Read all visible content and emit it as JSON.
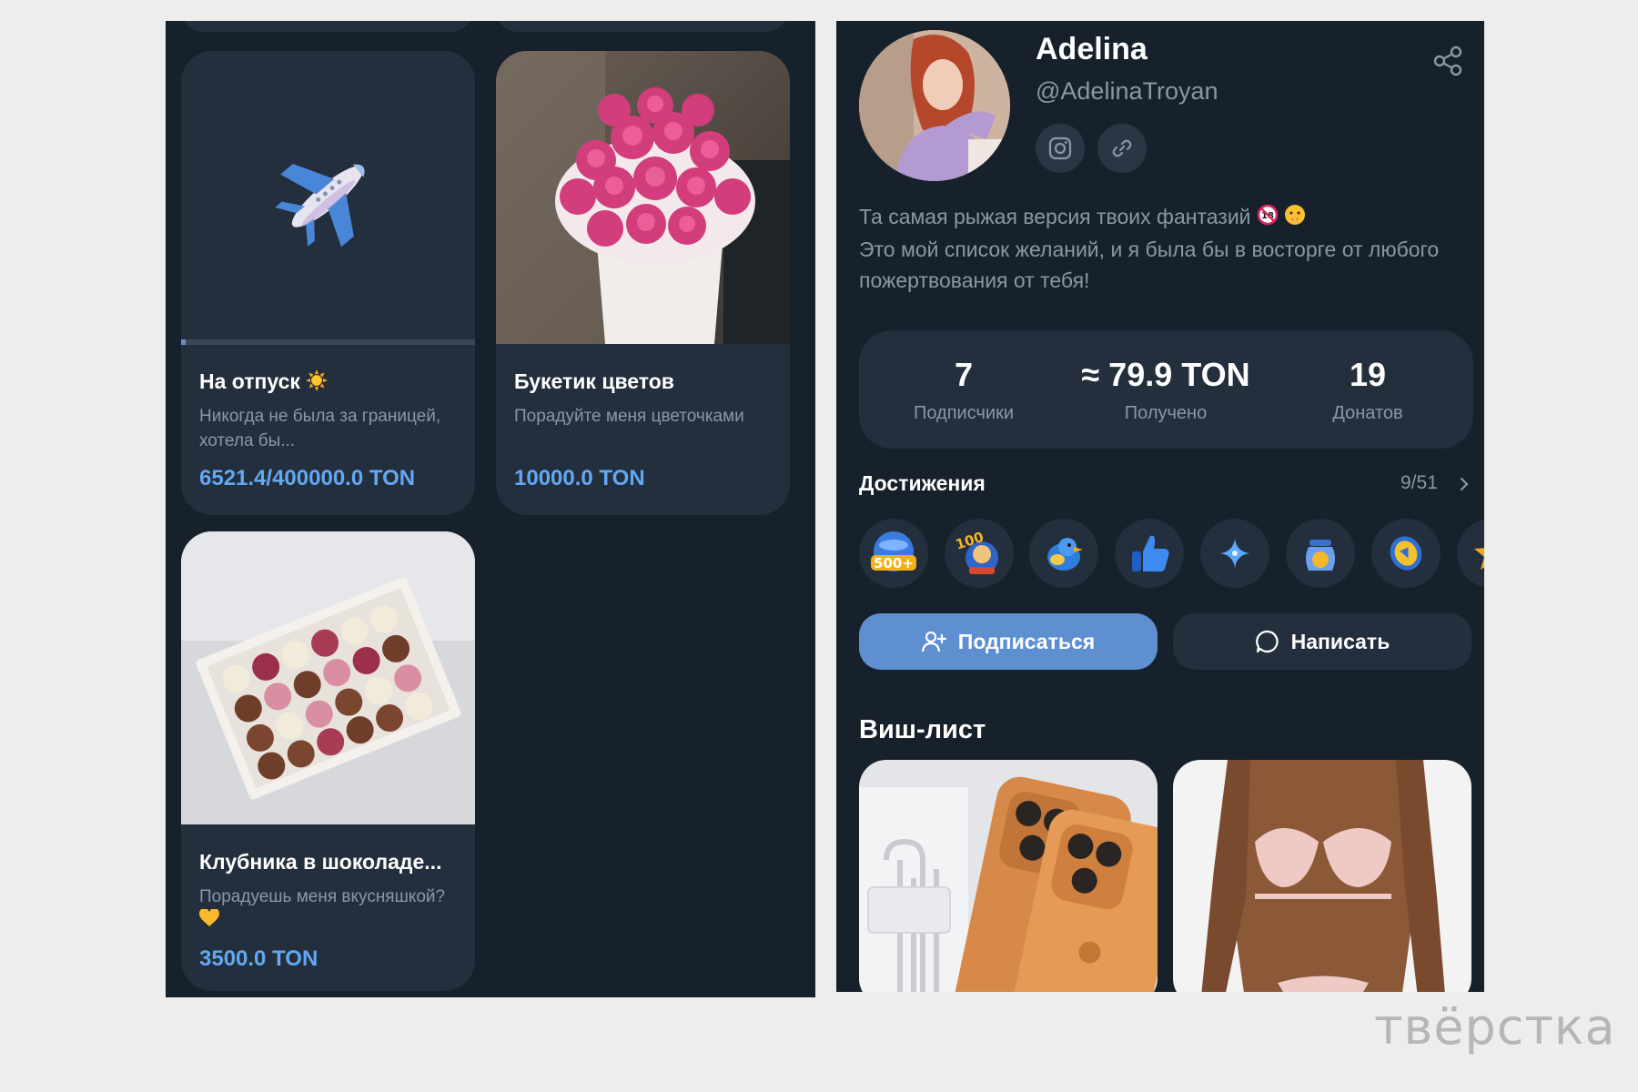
{
  "wishlist_cards": [
    {
      "title": "На отпуск",
      "description": "Никогда не была за границей, хотела бы...",
      "price": "6521.4/400000.0 TON",
      "progress_percent": 1.6,
      "image": "airplane-icon"
    },
    {
      "title": "Букетик цветов",
      "description": "Порадуйте меня цветочками",
      "price": "10000.0 TON",
      "image": "pink-roses-box-photo"
    },
    {
      "title": "Клубника в шоколаде...",
      "description": "Порадуешь меня вкусняшкой?",
      "price": "3500.0 TON",
      "image": "chocolate-strawberries-photo"
    }
  ],
  "profile": {
    "name": "Adelina",
    "handle": "@AdelinaTroyan",
    "bio_line1": "Та самая рыжая версия твоих фантазий",
    "bio_line2": "Это мой список желаний, и я была бы в восторге от любого пожертвования от тебя!"
  },
  "stats": [
    {
      "value": "7",
      "label": "Подписчики"
    },
    {
      "value": "≈ 79.9 TON",
      "label": "Получено"
    },
    {
      "value": "19",
      "label": "Донатов"
    }
  ],
  "achievements": {
    "title": "Достижения",
    "count": "9/51",
    "badges": [
      "500-plus-badge-icon",
      "100-badge-icon",
      "bird-badge-icon",
      "thumbs-up-badge-icon",
      "sparkle-badge-icon",
      "jar-badge-icon",
      "coin-badge-icon",
      "star-badge-icon"
    ]
  },
  "actions": {
    "subscribe_label": "Подписаться",
    "message_label": "Написать"
  },
  "wishlist": {
    "title": "Виш-лист",
    "thumbs": [
      "orange-phones-photo",
      "lingerie-photo"
    ]
  },
  "watermark": "твёрстка",
  "colors": {
    "background": "#ededed",
    "panel": "#17212b",
    "card": "#232f3c",
    "accent": "#5e8fd0",
    "price": "#63a8f2",
    "muted_text": "#8a97a6"
  }
}
